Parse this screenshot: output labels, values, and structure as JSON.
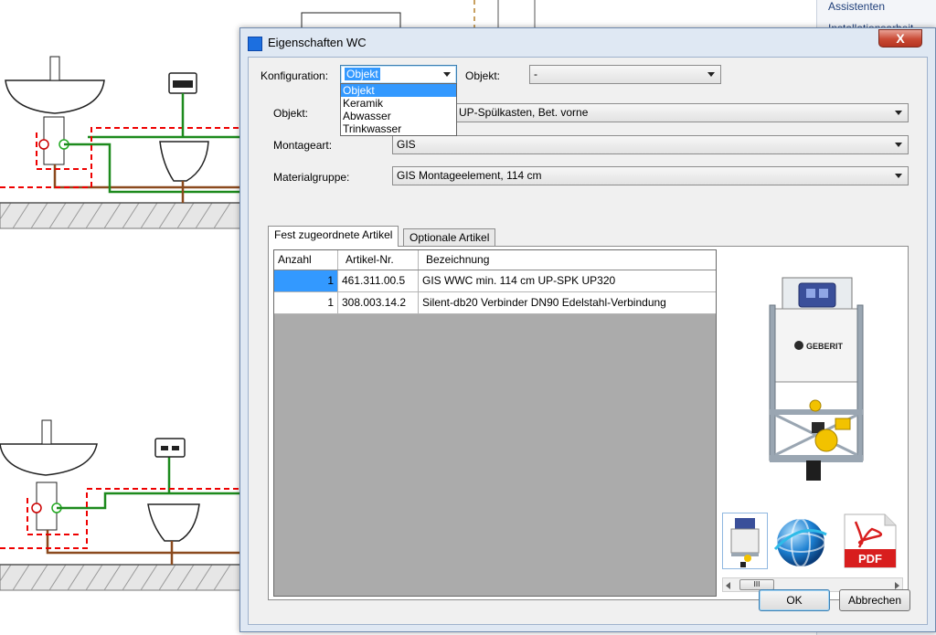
{
  "background_panel": {
    "items": [
      "Assistenten",
      "Installationsarbeit"
    ]
  },
  "dialog": {
    "title": "Eigenschaften WC",
    "close_label": "X",
    "konfiguration": {
      "label": "Konfiguration:",
      "value": "Objekt",
      "options": [
        "Objekt",
        "Keramik",
        "Abwasser",
        "Trinkwasser"
      ]
    },
    "objekt_top": {
      "label": "Objekt:",
      "value": "-"
    },
    "objekt": {
      "label": "Objekt:",
      "value": "UP-Spülkasten, Bet. vorne"
    },
    "montageart": {
      "label": "Montageart:",
      "value": "GIS"
    },
    "materialgruppe": {
      "label": "Materialgruppe:",
      "value": "GIS Montageelement, 114 cm"
    },
    "tabs": [
      {
        "label": "Fest zugeordnete Artikel"
      },
      {
        "label": "Optionale Artikel"
      }
    ],
    "table": {
      "headers": [
        "Anzahl",
        "Artikel-Nr.",
        "Bezeichnung"
      ],
      "rows": [
        {
          "anzahl": "1",
          "artikel": "461.311.00.5",
          "bezeichnung": "GIS WWC min. 114 cm UP-SPK UP320"
        },
        {
          "anzahl": "1",
          "artikel": "308.003.14.2",
          "bezeichnung": "Silent-db20 Verbinder DN90 Edelstahl-Verbindung"
        }
      ]
    },
    "product_brand": "GEBERIT",
    "pdf_label": "PDF",
    "ok_label": "OK",
    "cancel_label": "Abbrechen"
  }
}
